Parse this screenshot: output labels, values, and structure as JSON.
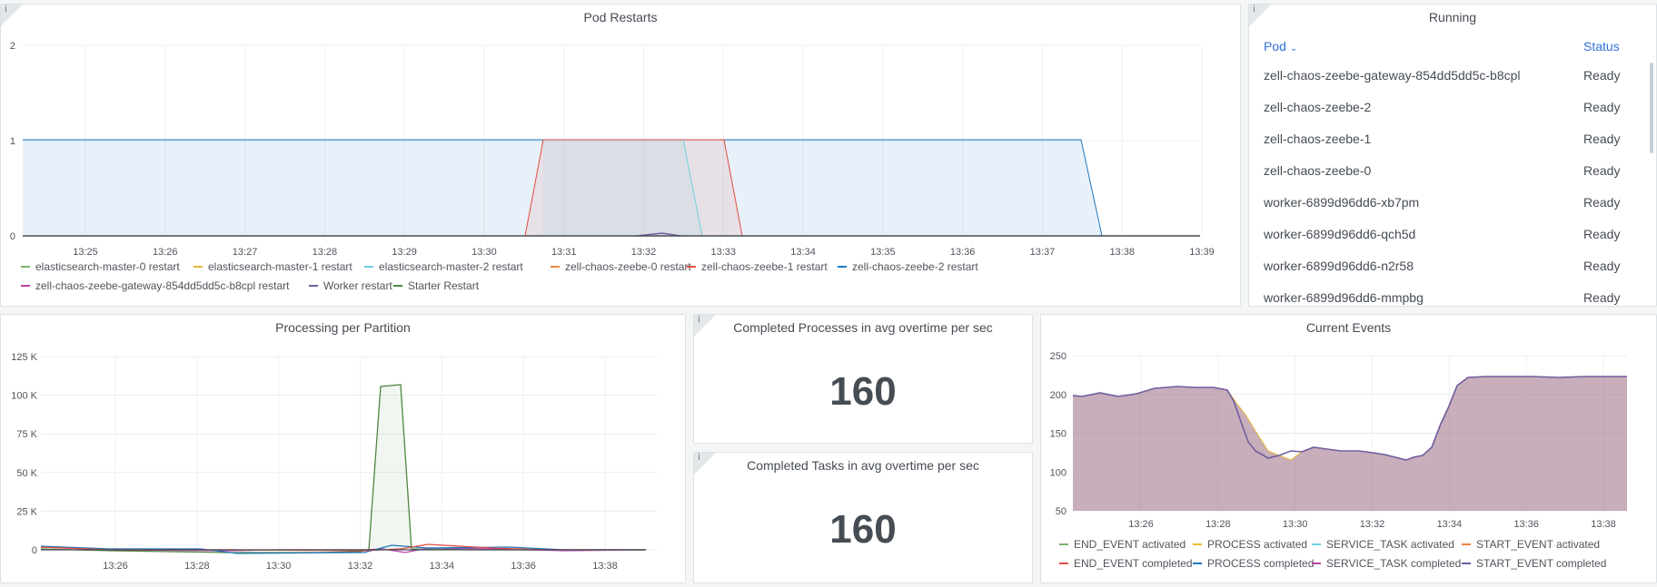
{
  "pod_restarts": {
    "title": "Pod Restarts",
    "info_icon": "info-icon",
    "yticks": [
      "2",
      "1",
      "0"
    ],
    "xticks": [
      "13:25",
      "13:26",
      "13:27",
      "13:28",
      "13:29",
      "13:30",
      "13:31",
      "13:32",
      "13:33",
      "13:34",
      "13:35",
      "13:36",
      "13:37",
      "13:38",
      "13:39"
    ],
    "legend": [
      {
        "label": "elasticsearch-master-0 restart",
        "color": "#7eb26d"
      },
      {
        "label": "elasticsearch-master-1 restart",
        "color": "#eab839"
      },
      {
        "label": "elasticsearch-master-2 restart",
        "color": "#6ed0e0"
      },
      {
        "label": "zell-chaos-zeebe-0 restart",
        "color": "#ef843c"
      },
      {
        "label": "zell-chaos-zeebe-1 restart",
        "color": "#e24d42"
      },
      {
        "label": "zell-chaos-zeebe-2 restart",
        "color": "#1f78c1"
      },
      {
        "label": "zell-chaos-zeebe-gateway-854dd5dd5c-b8cpl restart",
        "color": "#ba43a9"
      },
      {
        "label": "Worker restart",
        "color": "#705da0"
      },
      {
        "label": "Starter Restart",
        "color": "#508642"
      }
    ]
  },
  "running": {
    "title": "Running",
    "col_pod": "Pod",
    "col_status": "Status",
    "rows": [
      {
        "pod": "zell-chaos-zeebe-gateway-854dd5dd5c-b8cpl",
        "status": "Ready"
      },
      {
        "pod": "zell-chaos-zeebe-2",
        "status": "Ready"
      },
      {
        "pod": "zell-chaos-zeebe-1",
        "status": "Ready"
      },
      {
        "pod": "zell-chaos-zeebe-0",
        "status": "Ready"
      },
      {
        "pod": "worker-6899d96dd6-xb7pm",
        "status": "Ready"
      },
      {
        "pod": "worker-6899d96dd6-qch5d",
        "status": "Ready"
      },
      {
        "pod": "worker-6899d96dd6-n2r58",
        "status": "Ready"
      },
      {
        "pod": "worker-6899d96dd6-mmpbg",
        "status": "Ready"
      }
    ]
  },
  "processing": {
    "title": "Processing per Partition",
    "yticks": [
      "125 K",
      "100 K",
      "75 K",
      "50 K",
      "25 K",
      "0"
    ],
    "xticks": [
      "13:26",
      "13:28",
      "13:30",
      "13:32",
      "13:34",
      "13:36",
      "13:38"
    ]
  },
  "completed_processes": {
    "title": "Completed Processes in avg overtime per sec",
    "value": "160"
  },
  "completed_tasks": {
    "title": "Completed Tasks in avg overtime per sec",
    "value": "160"
  },
  "current_events": {
    "title": "Current Events",
    "yticks": [
      "250",
      "200",
      "150",
      "100",
      "50"
    ],
    "xticks": [
      "13:26",
      "13:28",
      "13:30",
      "13:32",
      "13:34",
      "13:36",
      "13:38"
    ],
    "legend": [
      {
        "label": "END_EVENT activated",
        "color": "#7eb26d"
      },
      {
        "label": "PROCESS activated",
        "color": "#eab839"
      },
      {
        "label": "SERVICE_TASK activated",
        "color": "#6ed0e0"
      },
      {
        "label": "START_EVENT activated",
        "color": "#ef843c"
      },
      {
        "label": "END_EVENT completed",
        "color": "#e24d42"
      },
      {
        "label": "PROCESS completed",
        "color": "#1f78c1"
      },
      {
        "label": "SERVICE_TASK completed",
        "color": "#ba43a9"
      },
      {
        "label": "START_EVENT completed",
        "color": "#705da0"
      }
    ]
  }
}
